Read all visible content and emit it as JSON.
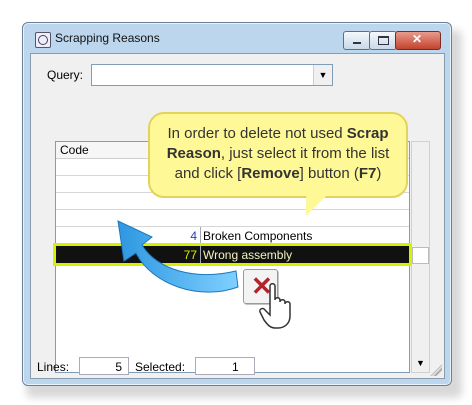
{
  "window": {
    "title": "Scrapping Reasons",
    "controls": {
      "minimize_icon": "minimize-icon",
      "maximize_icon": "maximize-icon",
      "close_icon": "close-icon"
    }
  },
  "query": {
    "label": "Query:",
    "value": ""
  },
  "list": {
    "columns": [
      "Code"
    ],
    "rows": [
      {
        "code": "4",
        "reason": "Broken Components"
      },
      {
        "code": "77",
        "reason": "Wrong assembly",
        "selected": true
      }
    ]
  },
  "status": {
    "lines_label": "Lines:",
    "lines_value": "5",
    "selected_label": "Selected:",
    "selected_value": "1"
  },
  "callout": {
    "p1": "In order to delete not used ",
    "b1": "Scrap Reason",
    "p2": ", just select it from the list and click [",
    "b2": "Remove",
    "p3": "] button (",
    "b3": "F7",
    "p4": ")"
  },
  "colors": {
    "accent_yellow": "#d6f000",
    "remove_icon": "#b0252a",
    "arrow_blue": "#3ea7e8"
  }
}
